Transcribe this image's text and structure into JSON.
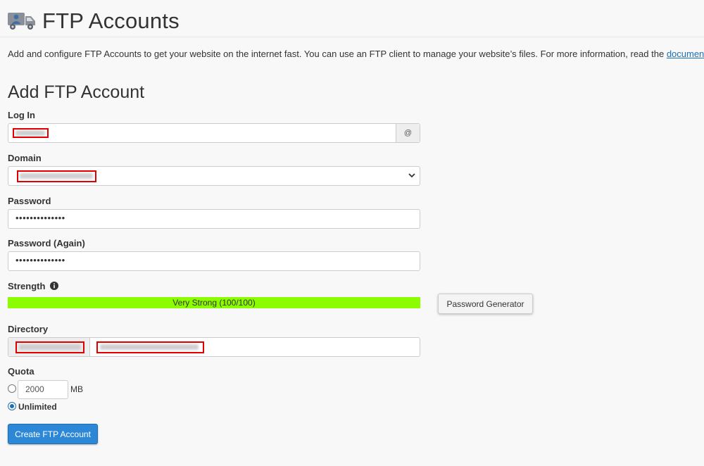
{
  "page": {
    "title": "FTP Accounts",
    "icon": "ftp-truck-icon",
    "description": "Add and configure FTP Accounts to get your website on the internet fast. You can use an FTP client to manage your website’s files. For more information, read the ",
    "doc_link": "documentation",
    "description_end": "."
  },
  "form": {
    "section_title": "Add FTP Account",
    "login_label": "Log In",
    "login_addon": "@",
    "domain_label": "Domain",
    "password_label": "Password",
    "password_value": "••••••••••••••",
    "password_again_label": "Password (Again)",
    "password_again_value": "••••••••••••••",
    "strength_label": "Strength",
    "strength_text": "Very Strong (100/100)",
    "strength_score": 100,
    "password_generator_label": "Password Generator",
    "directory_label": "Directory",
    "quota_label": "Quota",
    "quota_value": "2000",
    "quota_unit": "MB",
    "unlimited_label": "Unlimited",
    "unlimited_selected": true,
    "submit_label": "Create FTP Account"
  },
  "colors": {
    "strength_bar": "#8cfc00",
    "primary_button": "#2c88d6",
    "link": "#1c6fb5",
    "redaction_box": "#e00000"
  }
}
